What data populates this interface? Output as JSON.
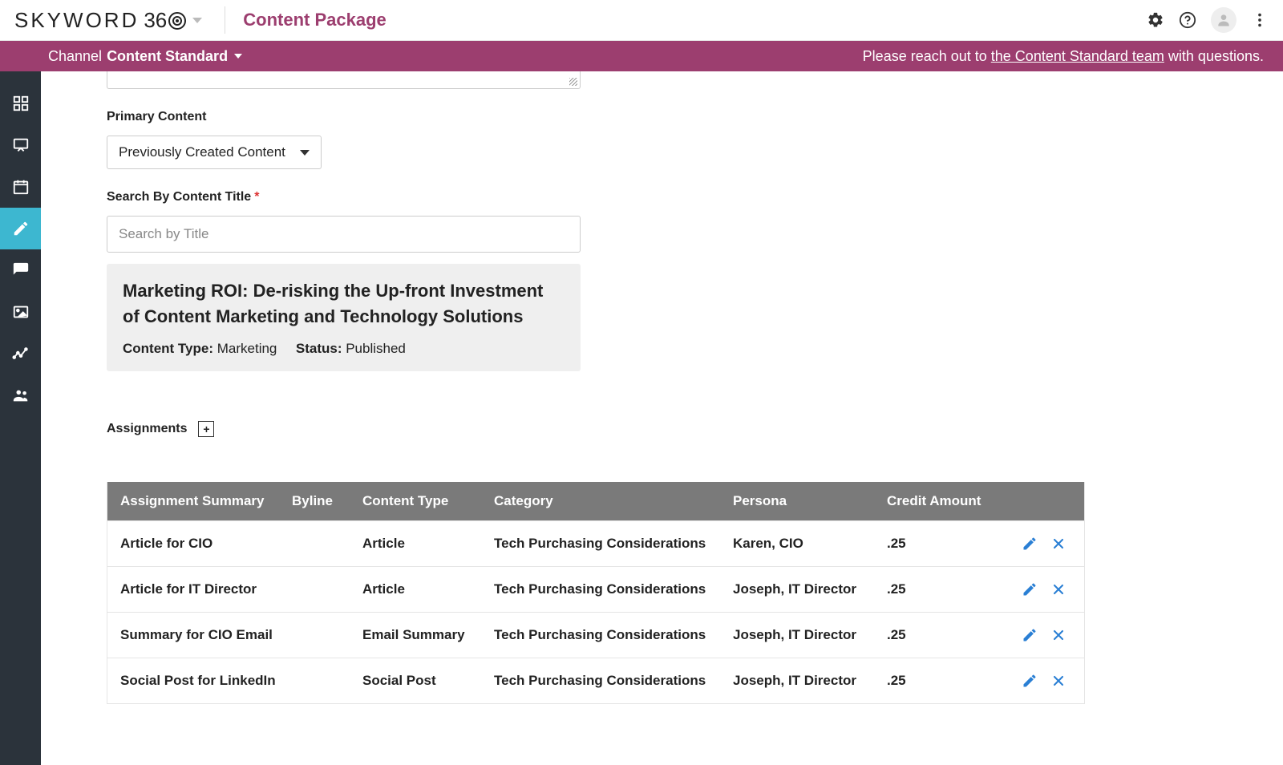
{
  "brand": {
    "name": "SKYWORD",
    "suffix": "36"
  },
  "page_title": "Content Package",
  "channel": {
    "label": "Channel",
    "value": "Content Standard"
  },
  "notice": {
    "prefix": "Please reach out to ",
    "link": "the Content Standard team",
    "suffix": " with questions."
  },
  "sidebar": [
    {
      "name": "dashboard-icon"
    },
    {
      "name": "presentation-icon"
    },
    {
      "name": "calendar-icon"
    },
    {
      "name": "edit-icon",
      "active": true
    },
    {
      "name": "comment-icon"
    },
    {
      "name": "image-icon"
    },
    {
      "name": "analytics-icon"
    },
    {
      "name": "people-icon"
    }
  ],
  "primary_content": {
    "label": "Primary Content",
    "selected": "Previously Created Content"
  },
  "search": {
    "label": "Search By Content Title",
    "placeholder": "Search by Title"
  },
  "result": {
    "title": "Marketing ROI: De-risking the Up-front Investment of Content Marketing and Technology Solutions",
    "content_type_label": "Content Type:",
    "content_type_value": "Marketing",
    "status_label": "Status:",
    "status_value": "Published"
  },
  "assignments": {
    "label": "Assignments",
    "headers": {
      "summary": "Assignment Summary",
      "byline": "Byline",
      "type": "Content Type",
      "category": "Category",
      "persona": "Persona",
      "credit": "Credit Amount"
    },
    "rows": [
      {
        "summary": "Article for CIO",
        "byline": "",
        "type": "Article",
        "category": "Tech Purchasing Considerations",
        "persona": "Karen, CIO",
        "credit": ".25"
      },
      {
        "summary": "Article for IT Director",
        "byline": "",
        "type": "Article",
        "category": "Tech Purchasing Considerations",
        "persona": "Joseph, IT Director",
        "credit": ".25"
      },
      {
        "summary": "Summary for CIO Email",
        "byline": "",
        "type": "Email Summary",
        "category": "Tech Purchasing Considerations",
        "persona": "Joseph, IT Director",
        "credit": ".25"
      },
      {
        "summary": "Social Post for LinkedIn",
        "byline": "",
        "type": "Social Post",
        "category": "Tech Purchasing Considerations",
        "persona": "Joseph, IT Director",
        "credit": ".25"
      }
    ]
  }
}
